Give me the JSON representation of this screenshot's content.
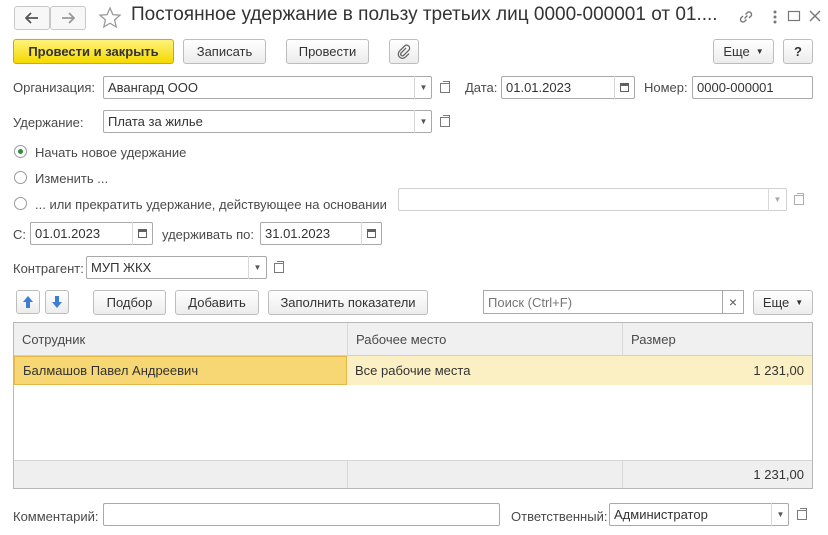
{
  "window": {
    "title": "Постоянное удержание в пользу третьих лиц 0000-000001 от 01...."
  },
  "toolbar": {
    "post_close_label": "Провести и закрыть",
    "save_label": "Записать",
    "post_label": "Провести",
    "more_label": "Еще",
    "help_label": "?"
  },
  "form": {
    "organization_label": "Организация:",
    "organization_value": "Авангард ООО",
    "date_label": "Дата:",
    "date_value": "01.01.2023",
    "number_label": "Номер:",
    "number_value": "0000-000001",
    "deduction_label": "Удержание:",
    "deduction_value": "Плата за жилье",
    "radio_new_label": "Начать новое удержание",
    "radio_change_label": "Изменить ...",
    "radio_stop_label": "... или прекратить удержание, действующее на основании",
    "from_label": "С:",
    "from_value": "01.01.2023",
    "until_label": "удерживать по:",
    "until_value": "31.01.2023",
    "counterparty_label": "Контрагент:",
    "counterparty_value": "МУП ЖКХ",
    "comment_label": "Комментарий:",
    "comment_value": "",
    "responsible_label": "Ответственный:",
    "responsible_value": "Администратор"
  },
  "table_toolbar": {
    "pick_label": "Подбор",
    "add_label": "Добавить",
    "fill_label": "Заполнить показатели",
    "search_placeholder": "Поиск (Ctrl+F)",
    "more_label": "Еще",
    "clear_symbol": "×"
  },
  "table": {
    "columns": [
      "Сотрудник",
      "Рабочее место",
      "Размер"
    ],
    "rows": [
      [
        "Балмашов Павел Андреевич",
        "Все рабочие места",
        "1 231,00"
      ]
    ],
    "total": "1 231,00"
  },
  "colors": {
    "primary_button": "#f5d900",
    "selected_row": "#fbf0c4",
    "selected_cell": "#f7d774",
    "radio_checked": "#2b8f3c",
    "arrow_icon": "#3b7fd4"
  }
}
